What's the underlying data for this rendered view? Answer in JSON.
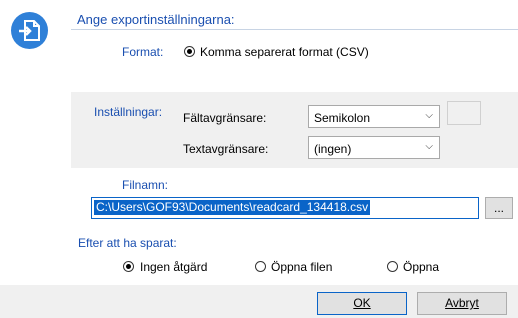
{
  "header": {
    "title": "Ange exportinställningarna:"
  },
  "format": {
    "label": "Format:",
    "option": "Komma separerat format (CSV)"
  },
  "settings": {
    "label": "Inställningar:",
    "field_sep_label": "Fältavgränsare:",
    "field_sep_value": "Semikolon",
    "text_sep_label": "Textavgränsare:",
    "text_sep_value": "(ingen)"
  },
  "file": {
    "label": "Filnamn:",
    "value": "C:\\Users\\GOF93\\Documents\\readcard_134418.csv",
    "browse_label": "..."
  },
  "after": {
    "label": "Efter att ha sparat:",
    "options": [
      "Ingen åtgärd",
      "Öppna filen",
      "Öppna"
    ],
    "selected": "Ingen åtgärd"
  },
  "buttons": {
    "ok": "OK",
    "cancel": "Avbryt"
  },
  "colors": {
    "accent": "#1a4fb0",
    "icon": "#2f80d8",
    "selection": "#0a64c8"
  },
  "icons": {
    "header": "export-arrow-icon",
    "chevron": "chevron-down-icon"
  }
}
